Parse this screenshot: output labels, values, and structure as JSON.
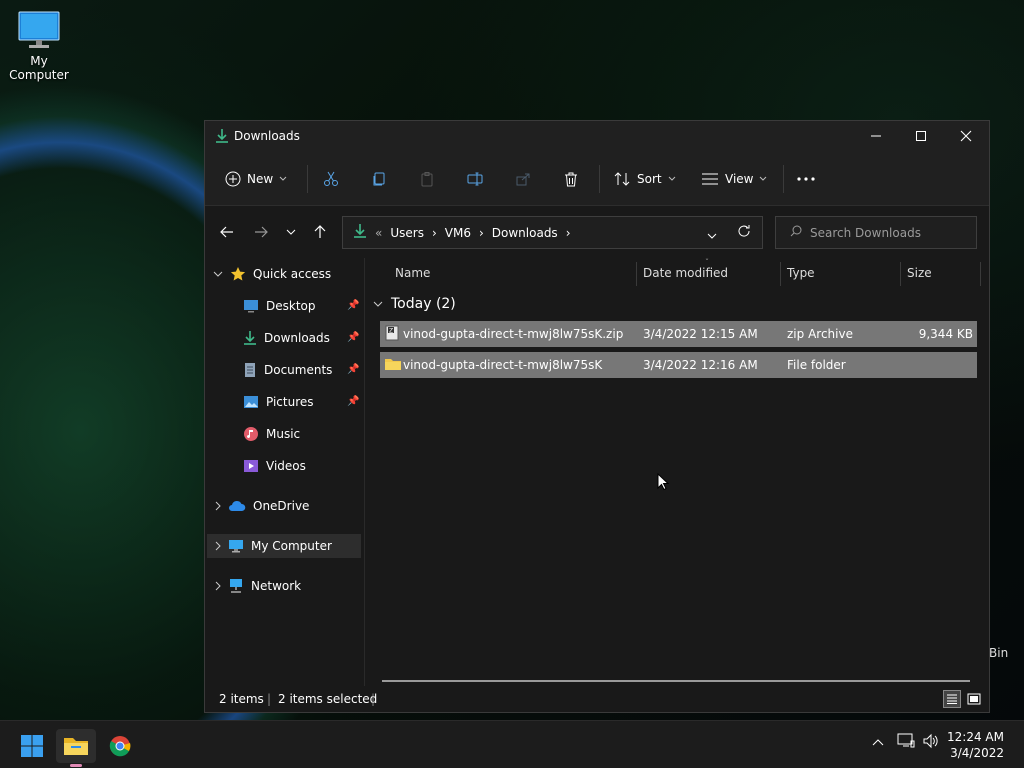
{
  "desktop": {
    "icons": [
      {
        "label": "My Computer"
      }
    ],
    "bin_partial": "Bin"
  },
  "window": {
    "title": "Downloads",
    "toolbar": {
      "new_label": "New",
      "sort_label": "Sort",
      "view_label": "View"
    },
    "address": {
      "overflow": "«",
      "crumbs": [
        "Users",
        "VM6",
        "Downloads"
      ]
    },
    "search": {
      "placeholder": "Search Downloads"
    },
    "sidebar": {
      "quick_access": "Quick access",
      "items": [
        "Desktop",
        "Downloads",
        "Documents",
        "Pictures",
        "Music",
        "Videos"
      ],
      "onedrive": "OneDrive",
      "my_computer": "My Computer",
      "network": "Network"
    },
    "columns": [
      "Name",
      "Date modified",
      "Type",
      "Size"
    ],
    "group": "Today (2)",
    "files": [
      {
        "name": "vinod-gupta-direct-t-mwj8lw75sK.zip",
        "date": "3/4/2022 12:15 AM",
        "type": "zip Archive",
        "size": "9,344 KB"
      },
      {
        "name": "vinod-gupta-direct-t-mwj8lw75sK",
        "date": "3/4/2022 12:16 AM",
        "type": "File folder",
        "size": ""
      }
    ],
    "status": {
      "count": "2 items",
      "selected": "2 items selected"
    }
  },
  "taskbar": {
    "time": "12:24 AM",
    "date": "3/4/2022"
  },
  "colors": {
    "accent_green": "#3fb98a",
    "selection": "#777777",
    "window_bg": "#191919"
  }
}
